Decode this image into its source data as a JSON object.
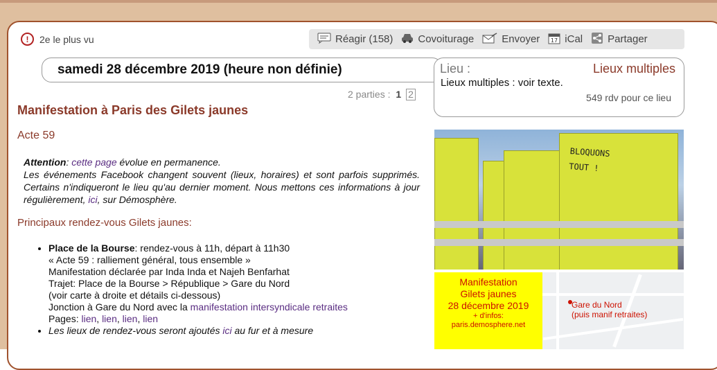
{
  "toolbar": {
    "most_viewed": "2e le plus vu",
    "react": "Réagir (158)",
    "carpool": "Covoiturage",
    "send": "Envoyer",
    "ical": "iCal",
    "share": "Partager"
  },
  "event": {
    "date": "samedi 28 décembre 2019 (heure non définie)",
    "lieu_label": "Lieu :",
    "lieu_value": "Lieux multiples",
    "lieu_desc": "Lieux multiples : voir texte.",
    "lieu_count": "549 rdv pour ce lieu",
    "parts_label": "2 parties :",
    "part1": "1",
    "part2": "2",
    "title": "Manifestation à Paris des Gilets jaunes",
    "subtitle": "Acte 59"
  },
  "attention": {
    "label": "Attention",
    "colon": ": ",
    "link": "cette page",
    "text1": " évolue en permanence.",
    "text2": "Les événements Facebook changent souvent (lieux, horaires) et sont parfois supprimés. Certains n'indiqueront le lieu qu'au dernier moment. Nous mettons ces informations à jour régulièrement, ",
    "link2": "ici",
    "text3": ", sur Démosphère."
  },
  "section": {
    "title": "Principaux rendez-vous Gilets jaunes:"
  },
  "rdv": {
    "place": "Place de la Bourse",
    "line1": ": rendez-vous à 11h, départ à 11h30",
    "line2": "« Acte 59 : ralliement général, tous ensemble »",
    "line3": "Manifestation déclarée par Inda Inda et Najeh Benfarhat",
    "line4": "Trajet: Place de la Bourse > République > Gare du Nord",
    "line5": "(voir carte à droite et détails ci-dessous)",
    "line6": "Jonction à Gare du Nord avec la ",
    "line6_link": "manifestation intersyndicale retraites",
    "pages_label": "Pages: ",
    "page_link": "lien",
    "comma": ", ",
    "more_text": "Les lieux de rendez-vous seront ajoutés ",
    "more_link": "ici",
    "more_end": " au fur et à mesure"
  },
  "photo": {
    "text1": "BLOQUONS",
    "text2": "TOUT !"
  },
  "poster": {
    "line1": "Manifestation",
    "line2": "Gilets jaunes",
    "line3": "28 décembre 2019",
    "line4": "+ d'infos:",
    "line5": "paris.demosphere.net"
  },
  "map": {
    "label1": "Gare du Nord",
    "label2": "(puis manif retraites)"
  }
}
